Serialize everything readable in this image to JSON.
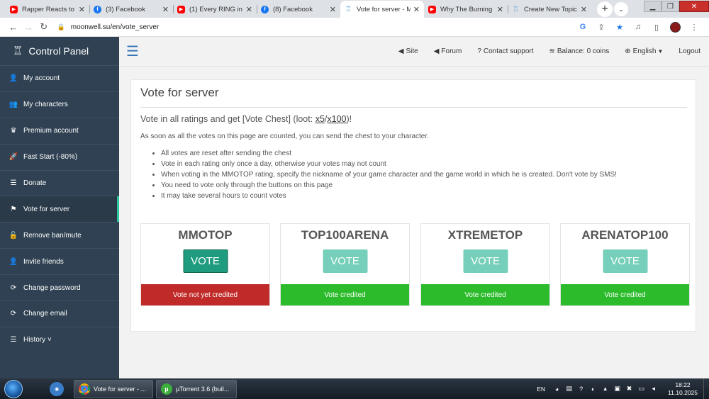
{
  "browser": {
    "tabs": [
      {
        "title": "Rapper Reacts to V",
        "icon": "youtube-icon",
        "active": false
      },
      {
        "title": "(3) Facebook",
        "icon": "facebook-icon",
        "active": false
      },
      {
        "title": "(1) Every RING in E",
        "icon": "youtube-icon",
        "active": false
      },
      {
        "title": "(8) Facebook",
        "icon": "facebook-icon",
        "active": false
      },
      {
        "title": "Vote for server - M",
        "icon": "moonwell-icon",
        "active": true
      },
      {
        "title": "Why The Burning C",
        "icon": "youtube-icon",
        "active": false
      },
      {
        "title": "Create New Topic",
        "icon": "moonwell-icon",
        "active": false
      }
    ],
    "url": "moonwell.su/en/vote_server"
  },
  "sidebar": {
    "brand": "Control Panel",
    "items": [
      {
        "label": "My account",
        "icon": "user-icon",
        "glyph": "👤"
      },
      {
        "label": "My characters",
        "icon": "users-icon",
        "glyph": "👥"
      },
      {
        "label": "Premium account",
        "icon": "crown-icon",
        "glyph": "♛"
      },
      {
        "label": "Fast Start (-80%)",
        "icon": "rocket-icon",
        "glyph": "🚀"
      },
      {
        "label": "Donate",
        "icon": "coins-icon",
        "glyph": "☰"
      },
      {
        "label": "Vote for server",
        "icon": "flag-icon",
        "glyph": "⚑"
      },
      {
        "label": "Remove ban/mute",
        "icon": "unlock-icon",
        "glyph": "🔓"
      },
      {
        "label": "Invite friends",
        "icon": "user-plus-icon",
        "glyph": "👤"
      },
      {
        "label": "Change password",
        "icon": "refresh-icon",
        "glyph": "⟳"
      },
      {
        "label": "Change email",
        "icon": "refresh-icon",
        "glyph": "⟳"
      },
      {
        "label": "History ˅",
        "icon": "list-icon",
        "glyph": "☰"
      }
    ]
  },
  "topnav": {
    "site": "Site",
    "forum": "Forum",
    "contact": "Contact support",
    "balance": "Balance: 0 coins",
    "language": "English",
    "logout": "Logout"
  },
  "page": {
    "title": "Vote for server",
    "subtitle_prefix": "Vote in all ratings and get [Vote Chest] (loot: ",
    "subtitle_x5": "x5",
    "subtitle_sep": "/",
    "subtitle_x100": "x100",
    "subtitle_suffix": ")!",
    "info": "As soon as all the votes on this page are counted, you can send the chest to your character.",
    "rules": [
      "All votes are reset after sending the chest",
      "Vote in each rating only once a day, otherwise your votes may not count",
      "When voting in the MMOTOP rating, specify the nickname of your game character and the game world in which he is created. Don't vote by SMS!",
      "You need to vote only through the buttons on this page",
      "It may take several hours to count votes"
    ],
    "ratings": [
      {
        "name": "MMOTOP",
        "button": "VOTE",
        "status": "Vote not yet credited",
        "credited": false
      },
      {
        "name": "TOP100ARENA",
        "button": "VOTE",
        "status": "Vote credited",
        "credited": true
      },
      {
        "name": "XTREMETOP",
        "button": "VOTE",
        "status": "Vote credited",
        "credited": true
      },
      {
        "name": "ARENATOP100",
        "button": "VOTE",
        "status": "Vote credited",
        "credited": true
      }
    ]
  },
  "taskbar": {
    "tasks": [
      {
        "label": "Vote for server - ...",
        "icon": "chrome-icon"
      },
      {
        "label": "µTorrent 3.6 (buil...",
        "icon": "utorrent-icon"
      }
    ],
    "lang": "EN",
    "time": "18:22",
    "date": "11.10.2025"
  },
  "colors": {
    "sidebar": "#2f4152",
    "accent": "#2ec4a0",
    "vote_active": "#1f9c7f",
    "vote_disabled": "#75cfba",
    "status_bad": "#c02b29",
    "status_good": "#2bbb2b"
  }
}
